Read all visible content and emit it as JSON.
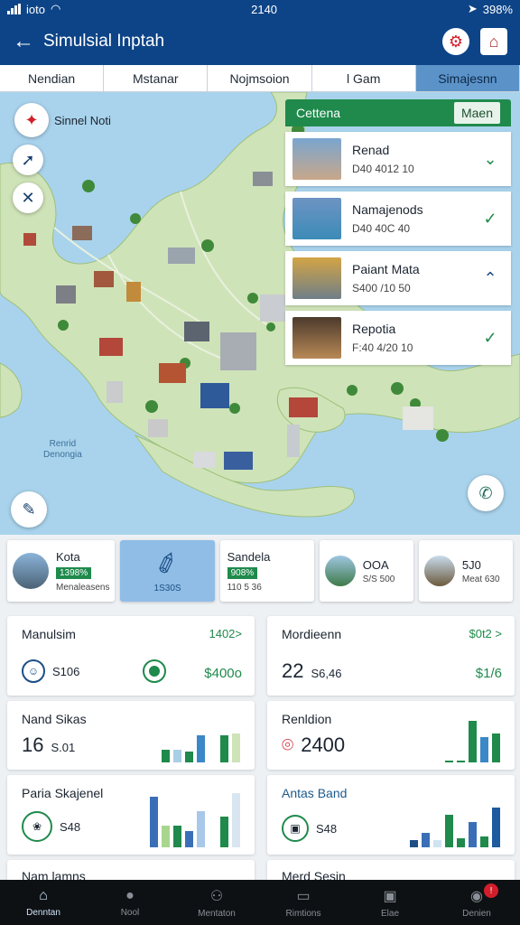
{
  "status": {
    "carrier": "ioto",
    "time": "2140",
    "battery": "398%"
  },
  "header": {
    "back_icon": "arrow-left-icon",
    "title": "Simulsial Inptah"
  },
  "tabs": [
    "Nendian",
    "Mstanar",
    "Nojmsoion",
    "l Gam",
    "Simajesnn"
  ],
  "map": {
    "pin_label": "Sinnel Noti",
    "water_label_1": "Renrid",
    "water_label_2": "Denongia"
  },
  "panel": {
    "header_left": "Cettena",
    "header_right": "Maen",
    "places": [
      {
        "name": "Renad",
        "meta": "D40 4012 10"
      },
      {
        "name": "Namajenods",
        "meta": "D40 40C 40"
      },
      {
        "name": "Paiant Mata",
        "meta": "S400 /10 50"
      },
      {
        "name": "Repotia",
        "meta": "F:40 4/20 10"
      }
    ]
  },
  "cities": [
    {
      "name": "Kota",
      "pct": "1398%",
      "sub": "Menaleasens"
    },
    {
      "name": "",
      "pct": "",
      "sub": "1S30S"
    },
    {
      "name": "Sandela",
      "pct": "908%",
      "sub": "110 5 36"
    },
    {
      "name": "OOA",
      "pct": "",
      "sub": "S/S 500"
    },
    {
      "name": "5J0",
      "pct": "",
      "sub": "Meat 630"
    }
  ],
  "stats": {
    "c1": {
      "title": "Manulsim",
      "right": "1402>",
      "value": "S106",
      "green": "$400o"
    },
    "c2": {
      "title": "Mordieenn",
      "right": "$0t2 >",
      "value": "22",
      "sub": "S6,46",
      "green": "$1/6"
    },
    "c3": {
      "title": "Nand Sikas",
      "value": "16",
      "sub": "S.01"
    },
    "c4": {
      "title": "Renldion",
      "value": "2400"
    },
    "c5": {
      "title": "Paria Skajenel",
      "value": "S48"
    },
    "c6": {
      "title": "Antas Band",
      "value": "S48"
    },
    "c7": {
      "title": "Nam lamns"
    },
    "c8": {
      "title": "Merd Sesin"
    }
  },
  "nav": [
    {
      "label": "Denntan",
      "icon": "home-icon"
    },
    {
      "label": "Nool",
      "icon": "pin-icon"
    },
    {
      "label": "Mentaton",
      "icon": "route-icon"
    },
    {
      "label": "Rimtions",
      "icon": "image-icon"
    },
    {
      "label": "Elae",
      "icon": "gallery-icon"
    },
    {
      "label": "Denien",
      "icon": "chat-icon",
      "badge": "!"
    }
  ],
  "colors": {
    "primary": "#0d4487",
    "accent": "#1f8a4c",
    "active_tab": "#5b93c9"
  }
}
